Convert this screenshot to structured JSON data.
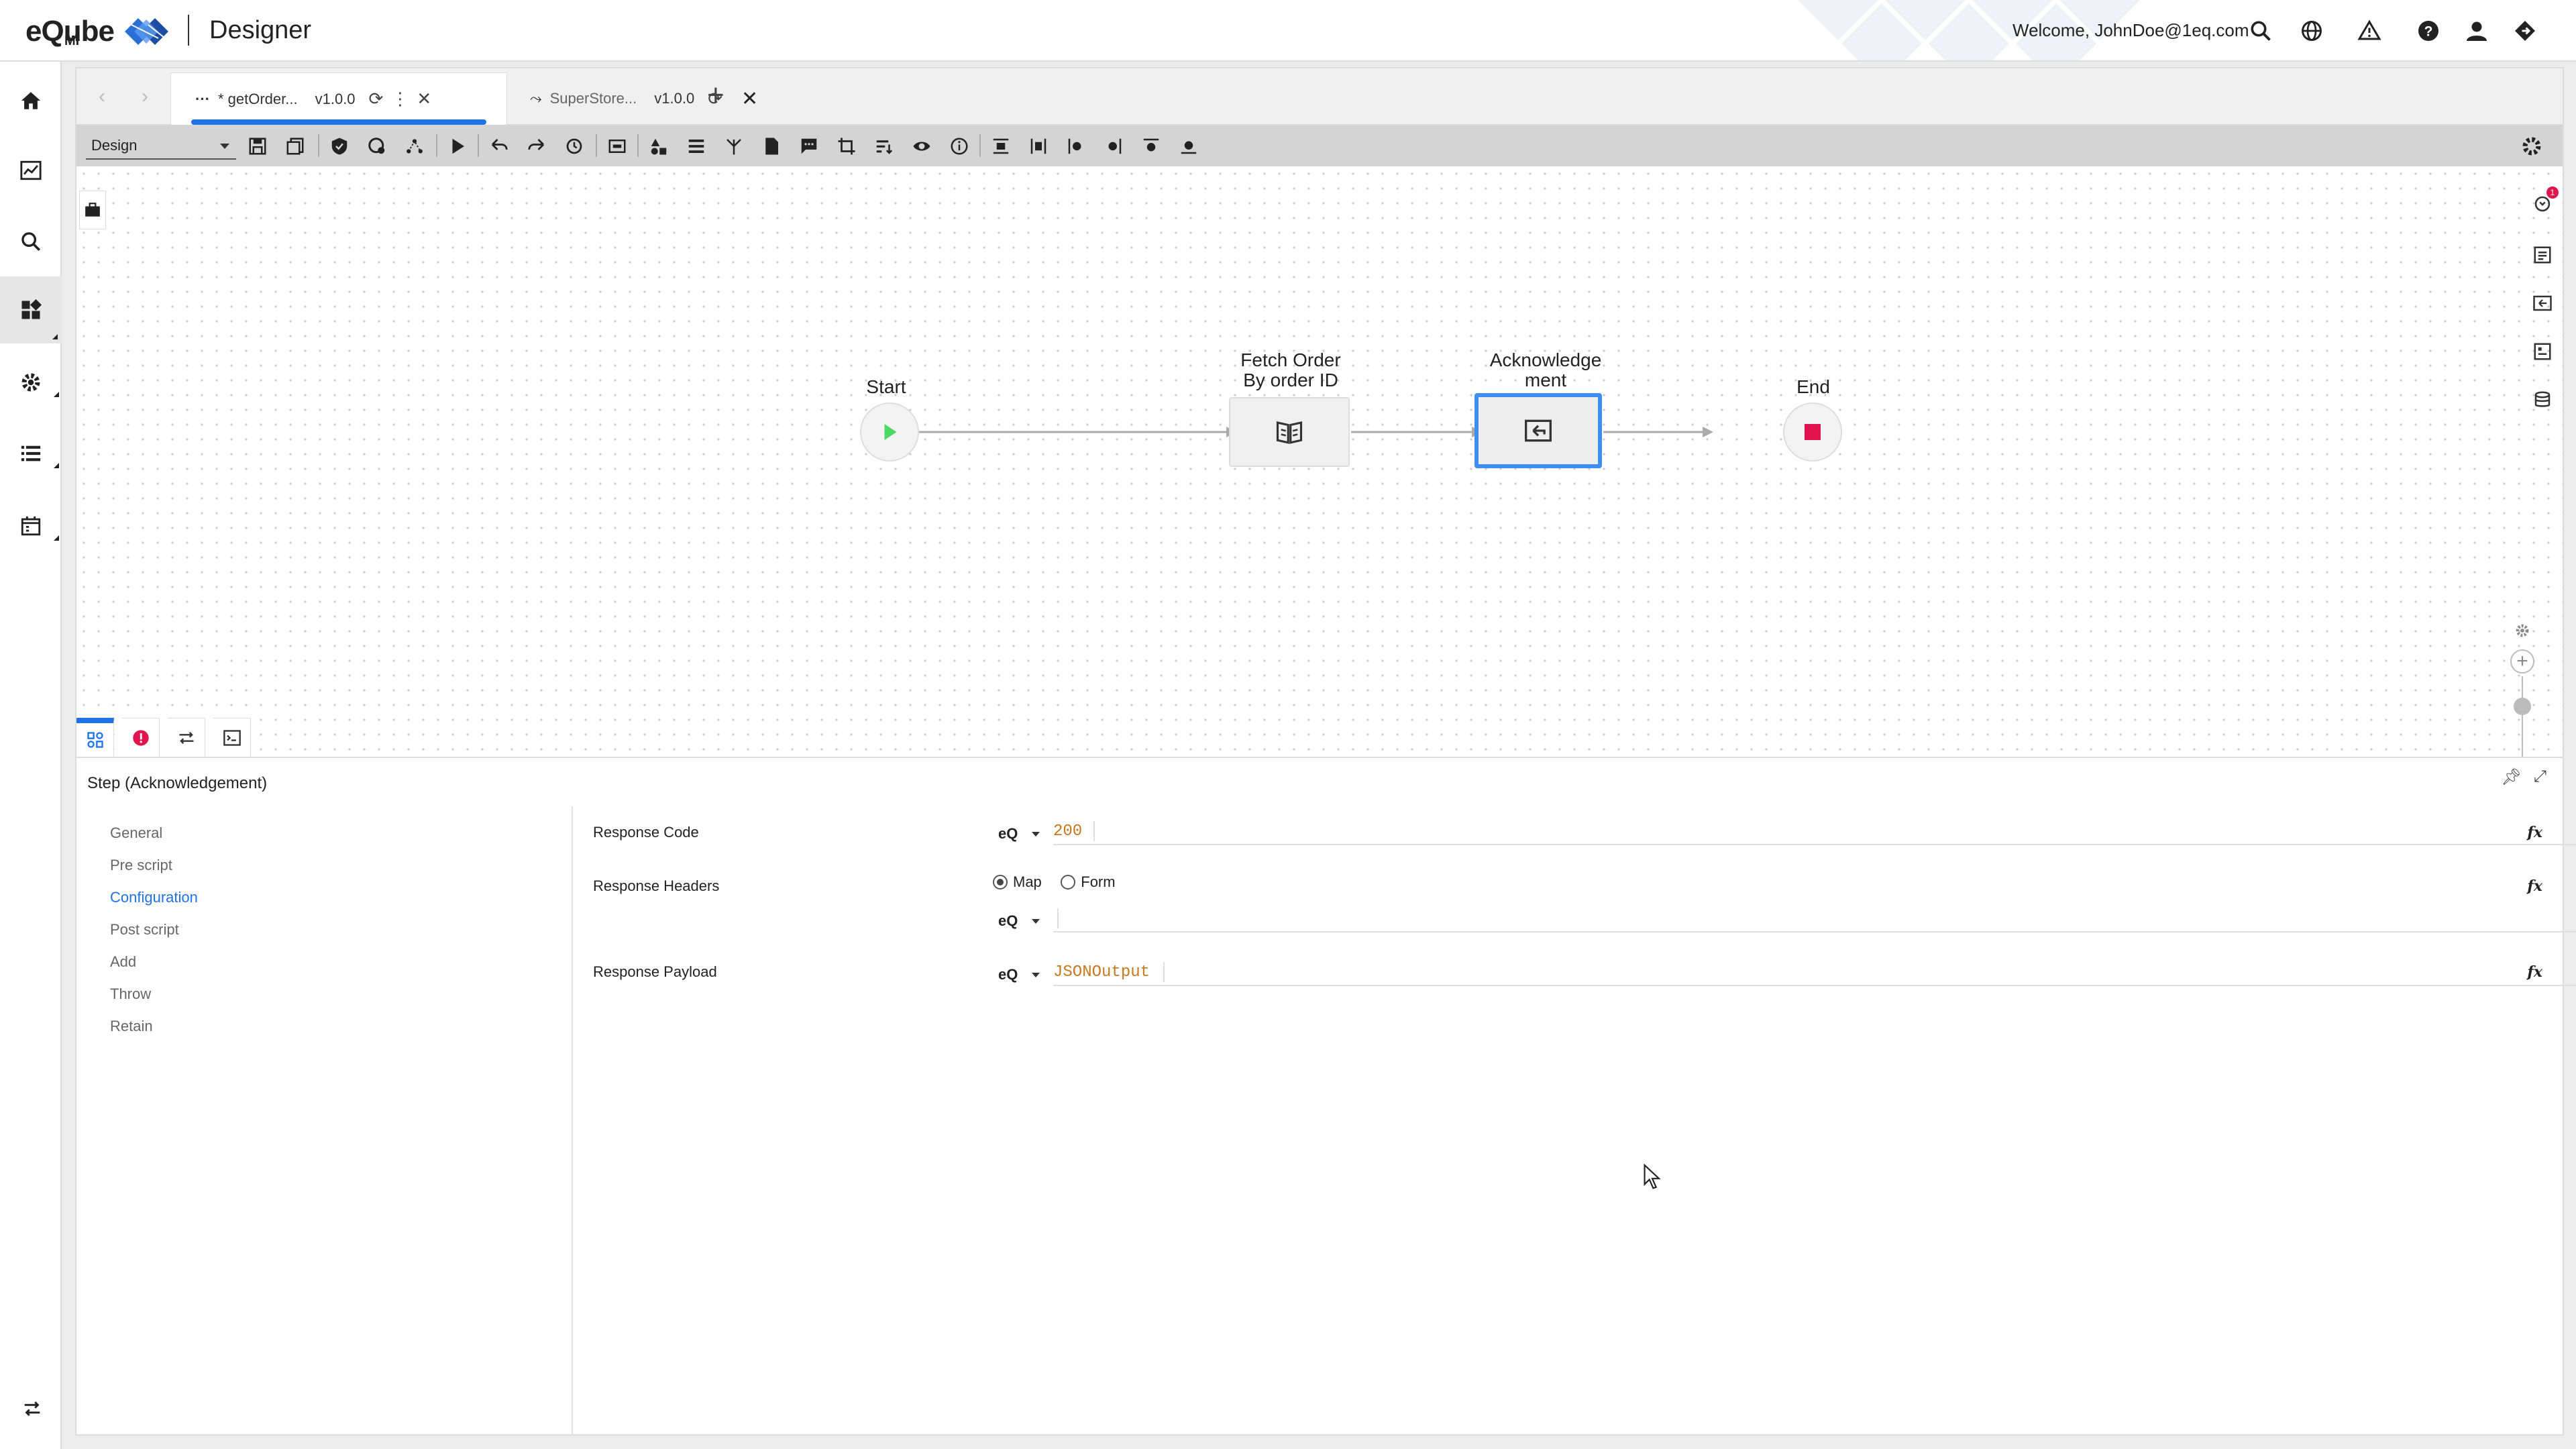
{
  "header": {
    "logo_text": "eQube",
    "logo_sub": "MI",
    "app_title": "Designer",
    "welcome": "Welcome, JohnDoe@1eq.com"
  },
  "tabs": [
    {
      "label": "* getOrder...",
      "version": "v1.0.0"
    },
    {
      "label": "SuperStore...",
      "version": "v1.0.0"
    }
  ],
  "toolbar": {
    "mode": "Design"
  },
  "flow": {
    "nodes": [
      {
        "label": "Start"
      },
      {
        "label": "Fetch Order\nBy order ID"
      },
      {
        "label": "Acknowledge\nment"
      },
      {
        "label": "End"
      }
    ]
  },
  "notification_badge": "1",
  "properties": {
    "title": "Step  (Acknowledgement)",
    "nav": [
      "General",
      "Pre script",
      "Configuration",
      "Post script",
      "Add",
      "Throw",
      "Retain"
    ],
    "active_nav": "Configuration",
    "fields": {
      "response_code": {
        "label": "Response Code",
        "mode": "eQ",
        "value": "200"
      },
      "response_headers": {
        "label": "Response Headers",
        "mode": "eQ",
        "options": [
          "Map",
          "Form"
        ],
        "selected": "Map"
      },
      "response_payload": {
        "label": "Response Payload",
        "mode": "eQ",
        "value": "JSONOutput"
      }
    },
    "fx_label": "fx"
  },
  "colors": {
    "accent": "#1e73e8",
    "start": "#4cd964",
    "end": "#e0154d",
    "code": "#c8781f"
  }
}
